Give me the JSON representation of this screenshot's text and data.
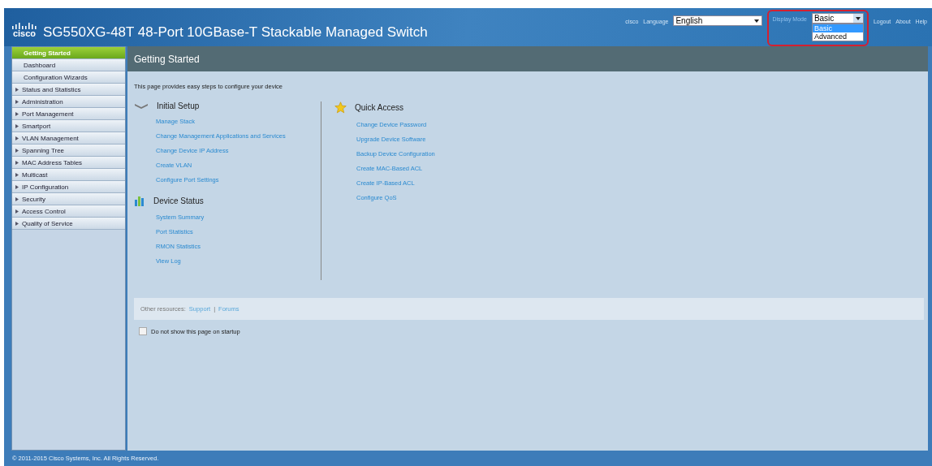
{
  "header": {
    "logo": "cisco",
    "title": "SG550XG-48T 48-Port 10GBase-T Stackable Managed Switch",
    "user": "cisco",
    "language_label": "Language",
    "language": "English",
    "display_mode_label": "Display Mode",
    "display_mode": "Basic",
    "display_mode_options": [
      {
        "label": "Basic",
        "selected": true
      },
      {
        "label": "Advanced",
        "selected": false
      }
    ],
    "links": [
      "Logout",
      "About",
      "Help"
    ]
  },
  "sidebar": {
    "items": [
      {
        "label": "Getting Started",
        "selected": true,
        "expandable": false
      },
      {
        "label": "Dashboard",
        "selected": false,
        "expandable": false
      },
      {
        "label": "Configuration Wizards",
        "selected": false,
        "expandable": false
      },
      {
        "label": "Status and Statistics",
        "selected": false,
        "expandable": true
      },
      {
        "label": "Administration",
        "selected": false,
        "expandable": true
      },
      {
        "label": "Port Management",
        "selected": false,
        "expandable": true
      },
      {
        "label": "Smartport",
        "selected": false,
        "expandable": true
      },
      {
        "label": "VLAN Management",
        "selected": false,
        "expandable": true
      },
      {
        "label": "Spanning Tree",
        "selected": false,
        "expandable": true
      },
      {
        "label": "MAC Address Tables",
        "selected": false,
        "expandable": true
      },
      {
        "label": "Multicast",
        "selected": false,
        "expandable": true
      },
      {
        "label": "IP Configuration",
        "selected": false,
        "expandable": true
      },
      {
        "label": "Security",
        "selected": false,
        "expandable": true
      },
      {
        "label": "Access Control",
        "selected": false,
        "expandable": true
      },
      {
        "label": "Quality of Service",
        "selected": false,
        "expandable": true
      }
    ]
  },
  "page": {
    "title": "Getting Started",
    "intro": "This page provides easy steps to configure your device",
    "sections": [
      {
        "kind": "setup",
        "title": "Initial Setup",
        "links": [
          "Manage Stack",
          "Change Management Applications and Services",
          "Change Device IP Address",
          "Create VLAN",
          "Configure Port Settings"
        ]
      },
      {
        "kind": "status",
        "title": "Device Status",
        "links": [
          "System Summary",
          "Port Statistics",
          "RMON Statistics",
          "View Log"
        ]
      },
      {
        "kind": "quick",
        "title": "Quick Access",
        "links": [
          "Change Device Password",
          "Upgrade Device Software",
          "Backup Device Configuration",
          "Create MAC-Based ACL",
          "Create IP-Based ACL",
          "Configure QoS"
        ]
      }
    ],
    "resources_label": "Other resources:",
    "resources": [
      "Support",
      "Forums"
    ],
    "resources_separator": "|",
    "startup_checkbox": {
      "label": "Do not show this page on startup",
      "checked": false
    }
  },
  "footer": "© 2011-2015 Cisco Systems, Inc. All Rights Reserved."
}
